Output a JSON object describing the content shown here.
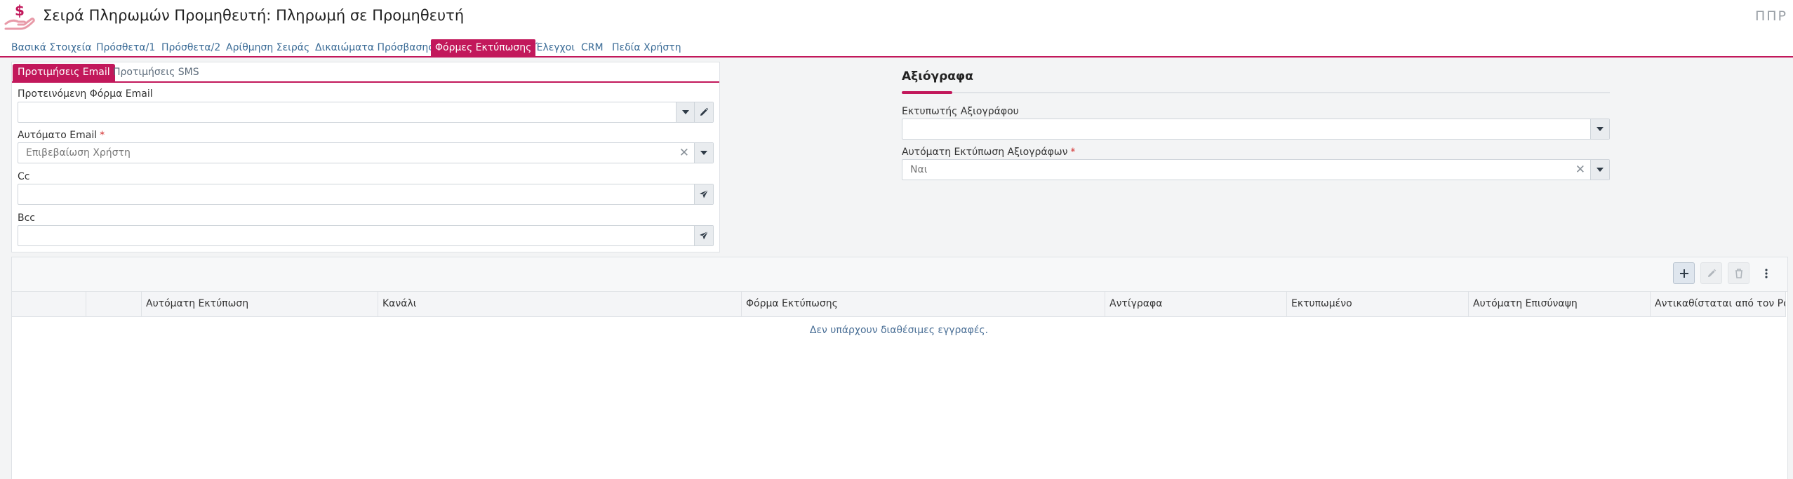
{
  "header": {
    "title": "Σειρά Πληρωμών Προμηθευτή: Πληρωμή σε Προμηθευτή",
    "code": "ΠΠΡ",
    "icon": "hand-dollar-icon"
  },
  "tabs": [
    {
      "label": "Βασικά Στοιχεία"
    },
    {
      "label": "Πρόσθετα/1"
    },
    {
      "label": "Πρόσθετα/2"
    },
    {
      "label": "Αρίθμηση Σειράς"
    },
    {
      "label": "Δικαιώματα Πρόσβασης"
    },
    {
      "label": "Φόρμες Εκτύπωσης",
      "active": true
    },
    {
      "label": "Έλεγχοι"
    },
    {
      "label": "CRM"
    },
    {
      "label": "Πεδία Χρήστη"
    }
  ],
  "email_panel": {
    "subtabs": [
      {
        "label": "Προτιμήσεις Email",
        "active": true
      },
      {
        "label": "Προτιμήσεις SMS"
      }
    ],
    "preferred_form": {
      "label": "Προτεινόμενη Φόρμα Email",
      "value": ""
    },
    "auto_email": {
      "label": "Αυτόματο Email",
      "required": "*",
      "value": "Επιβεβαίωση Χρήστη"
    },
    "cc": {
      "label": "Cc",
      "value": ""
    },
    "bcc": {
      "label": "Bcc",
      "value": ""
    }
  },
  "cheques": {
    "title": "Αξιόγραφα",
    "printer": {
      "label": "Εκτυπωτής Αξιογράφου",
      "value": ""
    },
    "auto_print": {
      "label": "Αυτόματη Εκτύπωση Αξιογράφων",
      "required": "*",
      "value": "Ναι"
    }
  },
  "grid": {
    "columns": [
      "",
      "",
      "Αυτόματη Εκτύπωση",
      "Κανάλι",
      "Φόρμα Εκτύπωσης",
      "Αντίγραφα",
      "Εκτυπωμένο",
      "Αυτόματη Επισύναψη",
      "Αντικαθίσταται από τον Ρόλο."
    ],
    "empty_message": "Δεν υπάρχουν διαθέσιμες εγγραφές.",
    "toolbar": [
      "add-icon",
      "edit-icon",
      "delete-icon",
      "more-vertical-icon"
    ]
  },
  "colors": {
    "accent": "#c2185b",
    "link": "#3a6b96"
  }
}
